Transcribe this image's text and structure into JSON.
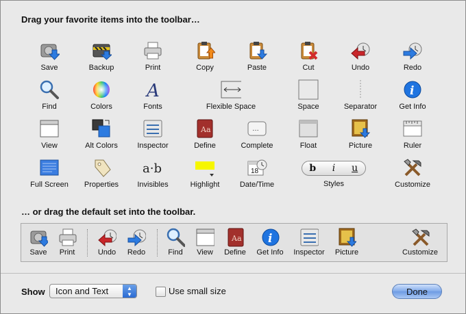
{
  "header": {
    "title": "Drag your favorite items into the toolbar…",
    "default_title": "… or drag the default set into the toolbar."
  },
  "palette": {
    "rows": [
      [
        {
          "label": "Save",
          "icon": "save-icon"
        },
        {
          "label": "Backup",
          "icon": "backup-icon"
        },
        {
          "label": "Print",
          "icon": "print-icon"
        },
        {
          "label": "Copy",
          "icon": "copy-icon"
        },
        {
          "label": "Paste",
          "icon": "paste-icon"
        },
        {
          "label": "Cut",
          "icon": "cut-icon"
        },
        {
          "label": "Undo",
          "icon": "undo-icon"
        },
        {
          "label": "Redo",
          "icon": "redo-icon"
        }
      ],
      [
        {
          "label": "Find",
          "icon": "find-icon"
        },
        {
          "label": "Colors",
          "icon": "colors-icon"
        },
        {
          "label": "Fonts",
          "icon": "fonts-icon"
        },
        {
          "label": "Flexible Space",
          "icon": "flexible-space-icon"
        },
        {
          "label": "Space",
          "icon": "space-icon"
        },
        {
          "label": "Separator",
          "icon": "separator-icon"
        },
        {
          "label": "Get Info",
          "icon": "info-icon"
        }
      ],
      [
        {
          "label": "View",
          "icon": "view-icon"
        },
        {
          "label": "Alt Colors",
          "icon": "alt-colors-icon"
        },
        {
          "label": "Inspector",
          "icon": "inspector-icon"
        },
        {
          "label": "Define",
          "icon": "dictionary-icon"
        },
        {
          "label": "Complete",
          "icon": "complete-icon"
        },
        {
          "label": "Float",
          "icon": "float-icon"
        },
        {
          "label": "Picture",
          "icon": "picture-icon"
        },
        {
          "label": "Ruler",
          "icon": "ruler-icon"
        }
      ],
      [
        {
          "label": "Full Screen",
          "icon": "full-screen-icon"
        },
        {
          "label": "Properties",
          "icon": "tag-icon"
        },
        {
          "label": "Invisibles",
          "icon": "invisibles-icon"
        },
        {
          "label": "Highlight",
          "icon": "highlight-icon"
        },
        {
          "label": "Date/Time",
          "icon": "calendar-icon"
        },
        {
          "label": "Styles",
          "icon": "styles-icon",
          "segments": [
            "b",
            "i",
            "u"
          ]
        },
        {
          "label": "Customize",
          "icon": "tools-icon"
        }
      ]
    ]
  },
  "default_set": [
    {
      "label": "Save",
      "icon": "save-icon"
    },
    {
      "label": "Print",
      "icon": "print-icon"
    },
    {
      "label": "Undo",
      "icon": "undo-icon"
    },
    {
      "label": "Redo",
      "icon": "redo-icon"
    },
    {
      "label": "Find",
      "icon": "find-icon"
    },
    {
      "label": "View",
      "icon": "view-icon"
    },
    {
      "label": "Define",
      "icon": "dictionary-icon"
    },
    {
      "label": "Get Info",
      "icon": "info-icon"
    },
    {
      "label": "Inspector",
      "icon": "inspector-icon"
    },
    {
      "label": "Picture",
      "icon": "picture-icon"
    },
    {
      "label": "Customize",
      "icon": "tools-icon"
    }
  ],
  "footer": {
    "show_label": "Show",
    "show_value": "Icon and Text",
    "small_size_label": "Use small size",
    "small_size_checked": false,
    "done_label": "Done"
  },
  "colors": {
    "accent": "#3b82f6",
    "cut_red": "#d22b2b",
    "highlight_yellow": "#f6f600"
  }
}
